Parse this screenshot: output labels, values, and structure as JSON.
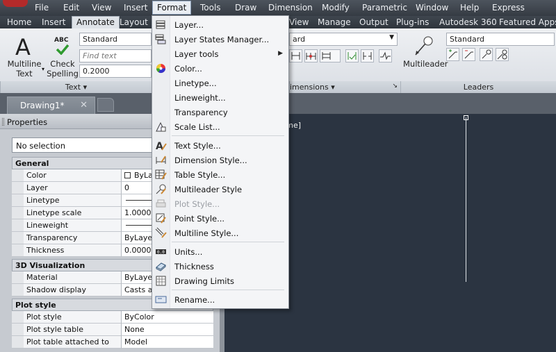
{
  "menubar": {
    "items": [
      "File",
      "Edit",
      "View",
      "Insert",
      "Format",
      "Tools",
      "Draw",
      "Dimension",
      "Modify",
      "Parametric",
      "Window",
      "Help",
      "Express"
    ],
    "active": "Format"
  },
  "ribbon_tabs": {
    "items": [
      "Home",
      "Insert",
      "Annotate",
      "Layout",
      "View",
      "Manage",
      "Output",
      "Plug-ins",
      "Autodesk 360",
      "Featured Apps"
    ],
    "active": "Annotate"
  },
  "ribbon": {
    "text_panel": {
      "multiline_text_label": [
        "Multiline",
        "Text"
      ],
      "check_spelling_label": [
        "Check",
        "Spelling"
      ],
      "abc_label": "ABC",
      "style_value": "Standard",
      "find_text_placeholder": "Find text",
      "height_value": "0.2000",
      "title": "Text ▾"
    },
    "dimensions_panel": {
      "style_fragment": "ard",
      "title": "imensions ▾",
      "corner": "↘"
    },
    "leaders_panel": {
      "multileader_label": "Multileader",
      "style_value": "Standard",
      "title": "Leaders"
    }
  },
  "document": {
    "tab_label": "Drawing1*",
    "close_glyph": "✕",
    "viewport_label": "rame]"
  },
  "properties": {
    "title": "Properties",
    "selection": "No selection",
    "sections": [
      {
        "name": "General",
        "rows": [
          {
            "key": "Color",
            "value": "ByLayer",
            "swatch": true
          },
          {
            "key": "Layer",
            "value": "0"
          },
          {
            "key": "Linetype",
            "value": "",
            "line": true
          },
          {
            "key": "Linetype scale",
            "value": "1.0000"
          },
          {
            "key": "Lineweight",
            "value": "",
            "line": true
          },
          {
            "key": "Transparency",
            "value": "ByLayer"
          },
          {
            "key": "Thickness",
            "value": "0.0000"
          }
        ]
      },
      {
        "name": "3D Visualization",
        "rows": [
          {
            "key": "Material",
            "value": "ByLayer"
          },
          {
            "key": "Shadow display",
            "value": "Casts and R"
          }
        ]
      },
      {
        "name": "Plot style",
        "rows": [
          {
            "key": "Plot style",
            "value": "ByColor"
          },
          {
            "key": "Plot style table",
            "value": "None"
          },
          {
            "key": "Plot table attached to",
            "value": "Model"
          }
        ]
      }
    ]
  },
  "format_menu": {
    "items": [
      {
        "label": "Layer...",
        "icon": "layer-icon"
      },
      {
        "label": "Layer States Manager...",
        "icon": "layer-states-icon"
      },
      {
        "label": "Layer tools",
        "icon": "",
        "submenu": true
      },
      {
        "label": "Color...",
        "icon": "color-wheel-icon"
      },
      {
        "label": "Linetype...",
        "icon": ""
      },
      {
        "label": "Lineweight...",
        "icon": ""
      },
      {
        "label": "Transparency",
        "icon": ""
      },
      {
        "label": "Scale List...",
        "icon": "scale-list-icon"
      },
      {
        "separator": true
      },
      {
        "label": "Text Style...",
        "icon": "text-style-icon"
      },
      {
        "label": "Dimension Style...",
        "icon": "dimension-style-icon"
      },
      {
        "label": "Table Style...",
        "icon": "table-style-icon"
      },
      {
        "label": "Multileader Style",
        "icon": "multileader-style-icon"
      },
      {
        "label": "Plot Style...",
        "icon": "plot-style-icon",
        "disabled": true
      },
      {
        "label": "Point Style...",
        "icon": "point-style-icon"
      },
      {
        "label": "Multiline Style...",
        "icon": "multiline-style-icon"
      },
      {
        "separator": true
      },
      {
        "label": "Units...",
        "icon": "units-icon"
      },
      {
        "label": "Thickness",
        "icon": "thickness-icon"
      },
      {
        "label": "Drawing Limits",
        "icon": "drawing-limits-icon"
      },
      {
        "separator": true
      },
      {
        "label": "Rename...",
        "icon": "rename-icon"
      }
    ]
  }
}
